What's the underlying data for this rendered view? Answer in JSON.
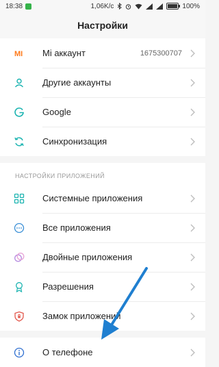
{
  "status": {
    "time": "18:38",
    "speed": "1,06K/c",
    "battery": "100%"
  },
  "header": {
    "title": "Настройки"
  },
  "accounts": {
    "items": [
      {
        "label": "Mi аккаунт",
        "value": "1675300707",
        "icon": "mi-logo-icon",
        "color": "#ff7a1a"
      },
      {
        "label": "Другие аккаунты",
        "icon": "person-icon",
        "color": "#19b3b0"
      },
      {
        "label": "Google",
        "icon": "google-g-icon",
        "color": "#19b3b0"
      },
      {
        "label": "Синхронизация",
        "icon": "sync-icon",
        "color": "#19b3b0"
      }
    ]
  },
  "apps": {
    "header": "НАСТРОЙКИ ПРИЛОЖЕНИЙ",
    "items": [
      {
        "label": "Системные приложения",
        "icon": "grid-icon",
        "color": "#19b3b0"
      },
      {
        "label": "Все приложения",
        "icon": "dots-circle-icon",
        "color": "#3a8fd6"
      },
      {
        "label": "Двойные приложения",
        "icon": "dual-circles-icon",
        "color": "#b58be0"
      },
      {
        "label": "Разрешения",
        "icon": "badge-icon",
        "color": "#19b3b0"
      },
      {
        "label": "Замок приложений",
        "icon": "shield-lock-icon",
        "color": "#e2574c"
      }
    ]
  },
  "device": {
    "items": [
      {
        "label": "О телефоне",
        "icon": "info-icon",
        "color": "#2f6fd0"
      }
    ]
  },
  "annotation": {
    "color": "#1f7fd0"
  }
}
